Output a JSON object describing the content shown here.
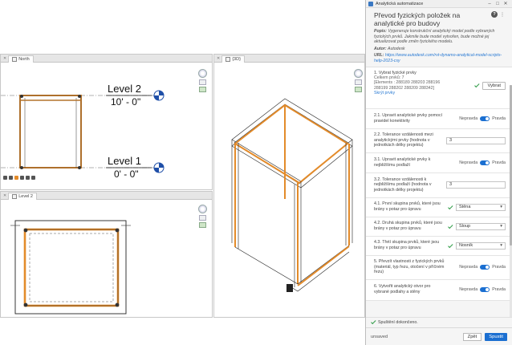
{
  "views": {
    "elevation": {
      "tab_label": "North"
    },
    "plan": {
      "tab_label": "Level 2"
    },
    "three_d": {
      "tab_label": "{3D}"
    },
    "levels": [
      {
        "name": "Level 2",
        "elevation": "10' - 0\""
      },
      {
        "name": "Level 1",
        "elevation": "0' - 0\""
      }
    ]
  },
  "window": {
    "title": "Analytická automatizace",
    "controls": [
      "–",
      "□",
      "✕"
    ]
  },
  "info": {
    "heading": "Převod fyzických položek na analytické pro budovy",
    "description_label": "Popis:",
    "description": "Vygeneruje konstrukční analytický model podle vybraných fyzických prvků. Jakmile bude model vytvořen, bude možné jej aktualizovat podle změn fyzického modelu.",
    "author_label": "Autor:",
    "author": "Autodesk",
    "url_label": "URL:",
    "url": "https://www.autodesk.com/rvt-dynamo-analytical-model-scripts-help-2023-csy",
    "help_icon": "question-icon",
    "close_icon": "close-icon"
  },
  "steps": [
    {
      "label": "1. Vybrat fyzické prvky",
      "lines": [
        "Celkem prvků: 7",
        "[Elements : 288189 288203 288196 288199 288202 288209 288342]"
      ],
      "link": "Skrýt prvky",
      "button": "Vybrat"
    },
    {
      "label": "2.1. Upravit analytické prvky pomocí pravidel konektivity",
      "off": "Nepravda",
      "on": "Pravda"
    },
    {
      "label": "2.2. Tolerance vzdálenosti mezi analytickými prvky (hodnota v jednotkách délky projektu)",
      "value": "3"
    },
    {
      "label": "3.1. Upravit analytické prvky k nejbližšímu podlaží",
      "off": "Nepravda",
      "on": "Pravda"
    },
    {
      "label": "3.2. Tolerance vzdálenosti k nejbližšímu podlaží (hodnota v jednotkách délky projektu)",
      "value": "3"
    },
    {
      "label": "4.1. První skupina prvků, které jsou brány v potaz pro úpravu",
      "selected": "Stěna"
    },
    {
      "label": "4.2. Druhá skupina prvků, které jsou brány v potaz pro úpravu",
      "selected": "Sloup"
    },
    {
      "label": "4.3. Třetí skupina prvků, které jsou brány v potaz pro úpravu",
      "selected": "Nosník"
    },
    {
      "label": "5. Převzít vlastnosti z fyzických prvků (materiál, typ řezu, otočení v příčném řezu)",
      "off": "Nepravda",
      "on": "Pravda"
    },
    {
      "label": "6. Vytvořit analytický otvor pro vybrané podlahy a stěny",
      "off": "Nepravda",
      "on": "Pravda"
    }
  ],
  "status": {
    "text": "Spuštění dokončeno."
  },
  "footer": {
    "state": "unsaved",
    "back": "Zpět",
    "run": "Spustit"
  },
  "colors": {
    "accent": "#1b6fd1",
    "physical": "#e38b2a",
    "check": "#2e9b46",
    "level_marker": "#1f4fa8"
  }
}
